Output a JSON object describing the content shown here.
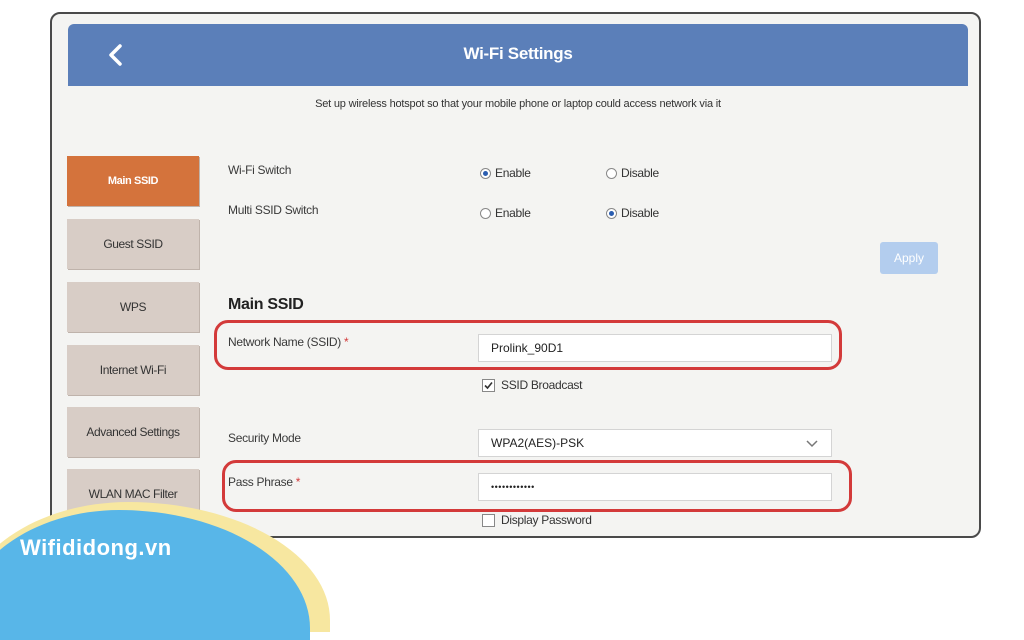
{
  "header": {
    "title": "Wi-Fi Settings",
    "back_icon": "chevron-left-icon"
  },
  "subtitle": "Set up wireless hotspot so that your mobile phone or laptop could access network via it",
  "sidebar": {
    "items": [
      {
        "label": "Main SSID",
        "active": true
      },
      {
        "label": "Guest SSID",
        "active": false
      },
      {
        "label": "WPS",
        "active": false
      },
      {
        "label": "Internet Wi-Fi",
        "active": false
      },
      {
        "label": "Advanced Settings",
        "active": false
      },
      {
        "label": "WLAN MAC Filter",
        "active": false
      }
    ]
  },
  "switches": {
    "wifi_switch": {
      "label": "Wi-Fi Switch",
      "enable_label": "Enable",
      "disable_label": "Disable",
      "selected": "Enable"
    },
    "multi_ssid_switch": {
      "label": "Multi SSID Switch",
      "enable_label": "Enable",
      "disable_label": "Disable",
      "selected": "Disable"
    }
  },
  "apply_label": "Apply",
  "main_ssid": {
    "title": "Main SSID",
    "network_name_label": "Network Name (SSID)",
    "required_mark": "*",
    "network_name_value": "Prolink_90D1",
    "ssid_broadcast_label": "SSID Broadcast",
    "ssid_broadcast_checked": true,
    "security_mode_label": "Security Mode",
    "security_mode_value": "WPA2(AES)-PSK",
    "pass_phrase_label": "Pass Phrase",
    "pass_phrase_value": "••••••••••••",
    "display_password_label": "Display Password",
    "display_password_checked": false
  },
  "watermark": "Wifididong.vn",
  "colors": {
    "header_bg": "#5b7fb9",
    "active_tab": "#d4733c",
    "inactive_tab": "#d8cdc6",
    "highlight": "#d33a3a",
    "apply_bg": "#b3cdee"
  }
}
